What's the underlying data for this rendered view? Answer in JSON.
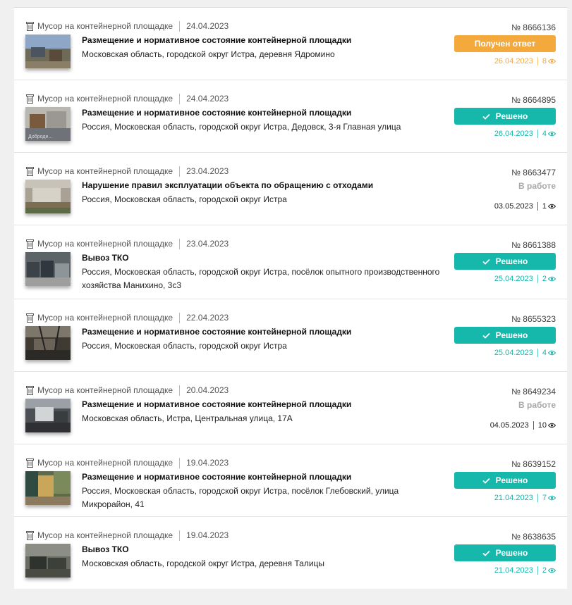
{
  "items": [
    {
      "category": "Мусор на контейнерной площадке",
      "date": "24.04.2023",
      "title": "Размещение и нормативное состояние контейнерной площадки",
      "address": "Московская область, городской округ Истра, деревня Ядромино",
      "number": "№ 8666136",
      "status": "Получен ответ",
      "status_type": "answered",
      "answer_date": "26.04.2023",
      "views": "8",
      "thumb_caption": ""
    },
    {
      "category": "Мусор на контейнерной площадке",
      "date": "24.04.2023",
      "title": "Размещение и нормативное состояние контейнерной площадки",
      "address": "Россия, Московская область, городской округ Истра, Дедовск, 3-я Главная улица",
      "number": "№ 8664895",
      "status": "Решено",
      "status_type": "solved",
      "answer_date": "26.04.2023",
      "views": "4",
      "thumb_caption": "Доброде..."
    },
    {
      "category": "Мусор на контейнерной площадке",
      "date": "23.04.2023",
      "title": "Нарушение правил эксплуатации объекта по обращению с отходами",
      "address": "Россия, Московская область, городской округ Истра",
      "number": "№ 8663477",
      "status": "В работе",
      "status_type": "in-progress",
      "answer_date": "03.05.2023",
      "views": "1",
      "thumb_caption": ""
    },
    {
      "category": "Мусор на контейнерной площадке",
      "date": "23.04.2023",
      "title": "Вывоз ТКО",
      "address": "Россия, Московская область, городской округ Истра, посёлок опытного производственного хозяйства Манихино, 3с3",
      "number": "№ 8661388",
      "status": "Решено",
      "status_type": "solved",
      "answer_date": "25.04.2023",
      "views": "2",
      "thumb_caption": ""
    },
    {
      "category": "Мусор на контейнерной площадке",
      "date": "22.04.2023",
      "title": "Размещение и нормативное состояние контейнерной площадки",
      "address": "Россия, Московская область, городской округ Истра",
      "number": "№ 8655323",
      "status": "Решено",
      "status_type": "solved",
      "answer_date": "25.04.2023",
      "views": "4",
      "thumb_caption": ""
    },
    {
      "category": "Мусор на контейнерной площадке",
      "date": "20.04.2023",
      "title": "Размещение и нормативное состояние контейнерной площадки",
      "address": "Московская область, Истра, Центральная улица, 17А",
      "number": "№ 8649234",
      "status": "В работе",
      "status_type": "in-progress",
      "answer_date": "04.05.2023",
      "views": "10",
      "thumb_caption": ""
    },
    {
      "category": "Мусор на контейнерной площадке",
      "date": "19.04.2023",
      "title": "Размещение и нормативное состояние контейнерной площадки",
      "address": "Россия, Московская область, городской округ Истра, посёлок Глебовский, улица Микрорайон, 41",
      "number": "№ 8639152",
      "status": "Решено",
      "status_type": "solved",
      "answer_date": "21.04.2023",
      "views": "7",
      "thumb_caption": ""
    },
    {
      "category": "Мусор на контейнерной площадке",
      "date": "19.04.2023",
      "title": "Вывоз ТКО",
      "address": "Московская область, городской округ Истра, деревня Талицы",
      "number": "№ 8638635",
      "status": "Решено",
      "status_type": "solved",
      "answer_date": "21.04.2023",
      "views": "2",
      "thumb_caption": ""
    }
  ],
  "colors": {
    "answered": "#f4a93c",
    "solved": "#16b8ac",
    "in_progress_text": "#a8a8a8",
    "background": "#f0f0f0"
  },
  "icons": {
    "category": "trash-bin-icon",
    "solved": "check-icon",
    "views": "eye-icon"
  }
}
